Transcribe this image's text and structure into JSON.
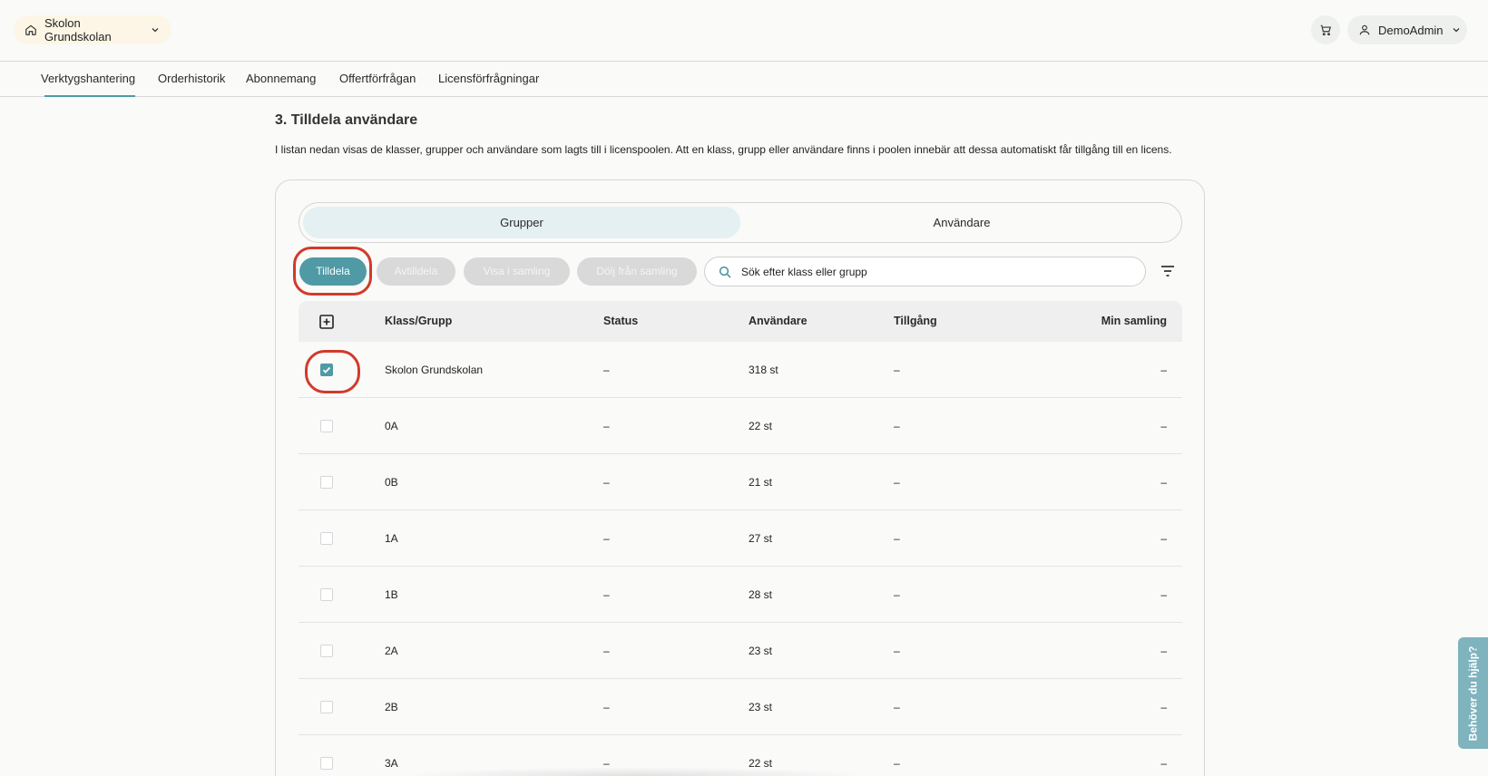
{
  "header": {
    "school": "Skolon Grundskolan",
    "user": "DemoAdmin"
  },
  "nav": {
    "items": [
      {
        "label": "Verktygshantering",
        "active": true
      },
      {
        "label": "Orderhistorik"
      },
      {
        "label": "Abonnemang"
      },
      {
        "label": "Offertförfrågan"
      },
      {
        "label": "Licensförfrågningar"
      }
    ]
  },
  "section": {
    "title": "3. Tilldela användare",
    "description": "I listan nedan visas de klasser, grupper och användare som lagts till i licenspoolen. Att en klass, grupp eller användare finns i poolen innebär att dessa automatiskt får tillgång till en licens."
  },
  "segments": {
    "groups": "Grupper",
    "users": "Användare",
    "active": "Grupper"
  },
  "actions": {
    "assign": "Tilldela",
    "unassign": "Avtilldela",
    "show_in_collection": "Visa i samling",
    "hide_from_collection": "Dölj från samling"
  },
  "search": {
    "placeholder": "Sök efter klass eller grupp"
  },
  "table": {
    "headers": {
      "group": "Klass/Grupp",
      "status": "Status",
      "users": "Användare",
      "access": "Tillgång",
      "collection": "Min samling"
    },
    "rows": [
      {
        "name": "Skolon Grundskolan",
        "status": "–",
        "users": "318 st",
        "access": "–",
        "collection": "–",
        "checked": true
      },
      {
        "name": "0A",
        "status": "–",
        "users": "22 st",
        "access": "–",
        "collection": "–",
        "checked": false
      },
      {
        "name": "0B",
        "status": "–",
        "users": "21 st",
        "access": "–",
        "collection": "–",
        "checked": false
      },
      {
        "name": "1A",
        "status": "–",
        "users": "27 st",
        "access": "–",
        "collection": "–",
        "checked": false
      },
      {
        "name": "1B",
        "status": "–",
        "users": "28 st",
        "access": "–",
        "collection": "–",
        "checked": false
      },
      {
        "name": "2A",
        "status": "–",
        "users": "23 st",
        "access": "–",
        "collection": "–",
        "checked": false
      },
      {
        "name": "2B",
        "status": "–",
        "users": "23 st",
        "access": "–",
        "collection": "–",
        "checked": false
      },
      {
        "name": "3A",
        "status": "–",
        "users": "22 st",
        "access": "–",
        "collection": "–",
        "checked": false
      }
    ]
  },
  "help": {
    "label": "Behöver du hjälp?"
  },
  "colors": {
    "accent": "#4f9aa5",
    "highlight": "#d23a2a",
    "school_pill": "#fdf6e6"
  }
}
